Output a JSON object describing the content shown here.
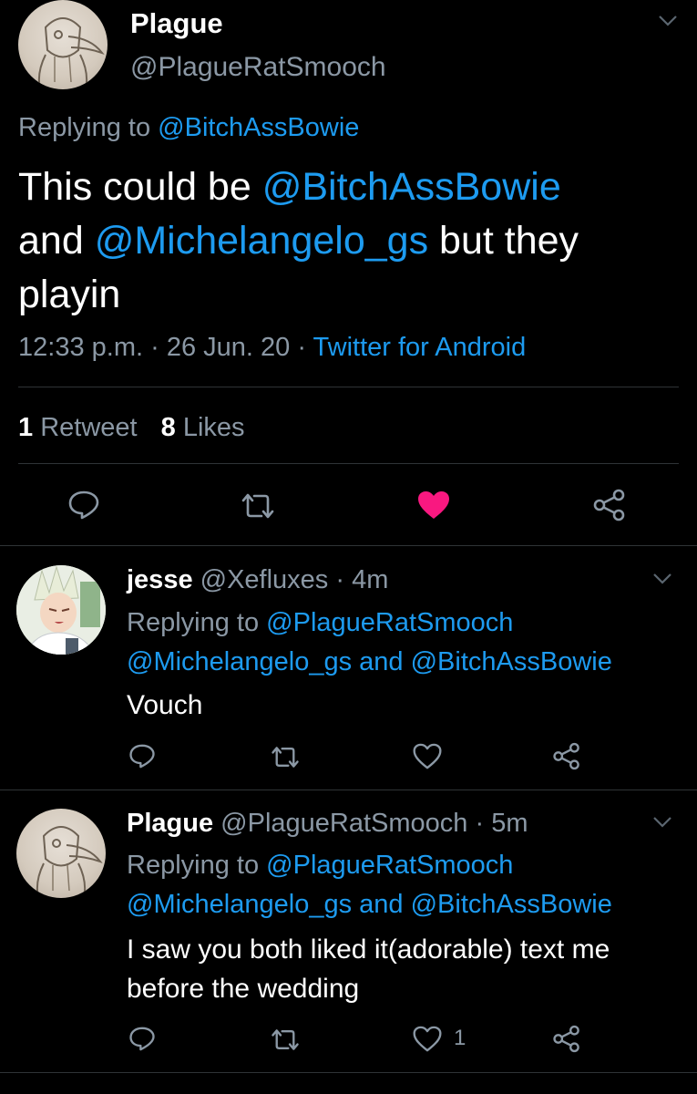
{
  "main_tweet": {
    "name": "Plague",
    "handle": "@PlagueRatSmooch",
    "replying_prefix": "Replying to ",
    "replying_to": "@BitchAssBowie",
    "text_line1_prefix": "This could be ",
    "text_mention1": "@BitchAssBowie",
    "text_line2_prefix": "and ",
    "text_mention2": "@Michelangelo_gs",
    "text_line2_suffix": " but they",
    "text_line3": "playin",
    "time": "12:33 p.m.",
    "sep1": " · ",
    "date": "26 Jun. 20",
    "sep2": " · ",
    "source": "Twitter for Android",
    "retweets_count": "1",
    "retweets_label": "Retweet",
    "likes_count": "8",
    "likes_label": "Likes"
  },
  "replies": [
    {
      "name": "jesse",
      "handle": "@Xefluxes",
      "dot": " · ",
      "age": "4m",
      "replying_prefix": "Replying to ",
      "replying_to1": "@PlagueRatSmooch",
      "replying_to2": "@Michelangelo_gs",
      "replying_and": " and ",
      "replying_to3": "@BitchAssBowie",
      "text_line1": "Vouch",
      "text_line2": "",
      "like_count": ""
    },
    {
      "name": "Plague",
      "handle": "@PlagueRatSmooch",
      "dot": " · ",
      "age": "5m",
      "replying_prefix": "Replying to ",
      "replying_to1": "@PlagueRatSmooch",
      "replying_to2": "@Michelangelo_gs",
      "replying_and": " and ",
      "replying_to3": "@BitchAssBowie",
      "text_line1": "I saw you both liked it(adorable) text me",
      "text_line2": "before the wedding",
      "like_count": "1"
    }
  ],
  "colors": {
    "background": "#000000",
    "link": "#1d9bf0",
    "muted": "#8b98a5",
    "like_active": "#f91880"
  },
  "icons": [
    "chevron-down-icon",
    "reply-icon",
    "retweet-icon",
    "heart-icon",
    "share-icon"
  ]
}
